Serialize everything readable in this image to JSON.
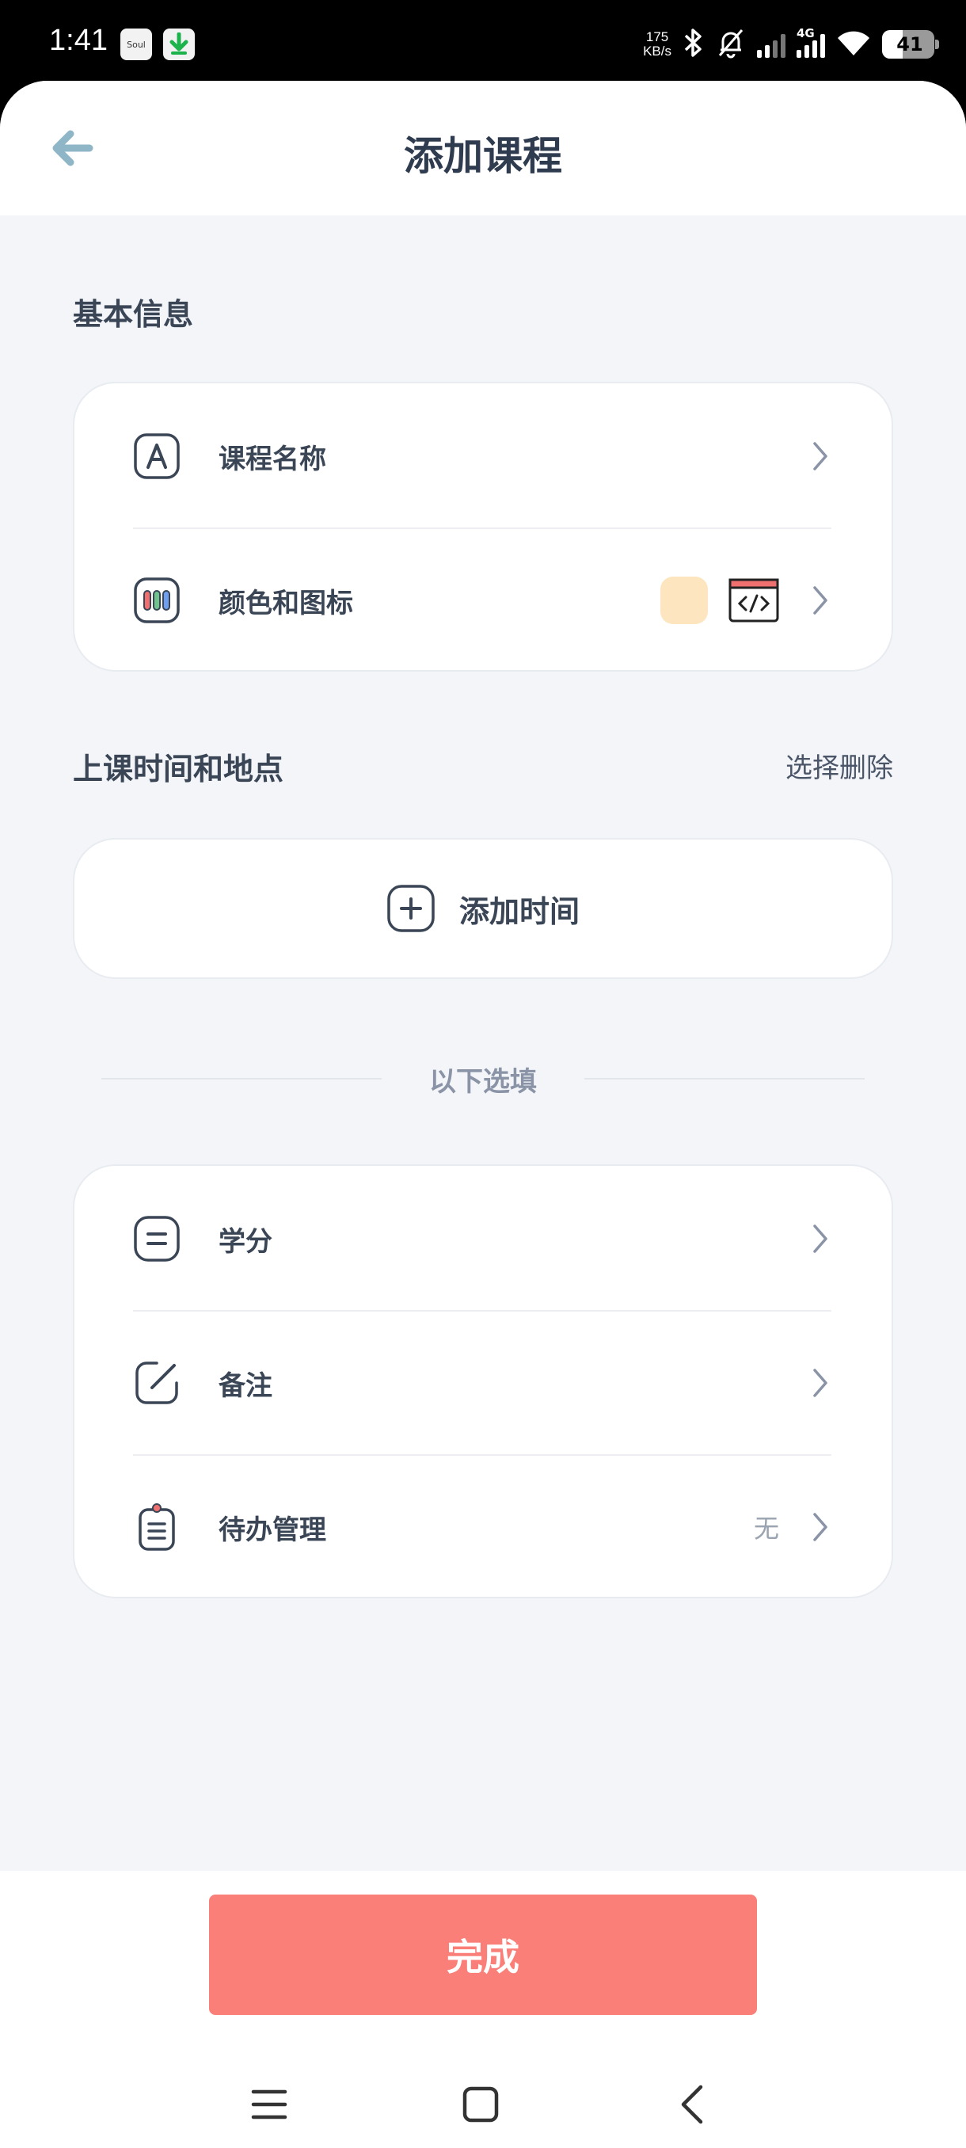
{
  "status_bar": {
    "time": "1:41",
    "soul_label": "Soul",
    "net_speed_value": "175",
    "net_speed_unit": "KB/s",
    "network_type": "4G",
    "battery_level": "41"
  },
  "header": {
    "title": "添加课程"
  },
  "basic_info": {
    "label": "基本信息",
    "rows": [
      {
        "label": "课程名称"
      },
      {
        "label": "颜色和图标"
      }
    ],
    "color_swatch": "#fde6bf"
  },
  "time_location": {
    "label": "上课时间和地点",
    "action": "选择删除",
    "add_time_label": "添加时间"
  },
  "optional": {
    "divider_label": "以下选填",
    "rows": [
      {
        "label": "学分",
        "value": ""
      },
      {
        "label": "备注",
        "value": ""
      },
      {
        "label": "待办管理",
        "value": "无"
      }
    ]
  },
  "footer": {
    "done_label": "完成",
    "accent": "#f97f78"
  }
}
